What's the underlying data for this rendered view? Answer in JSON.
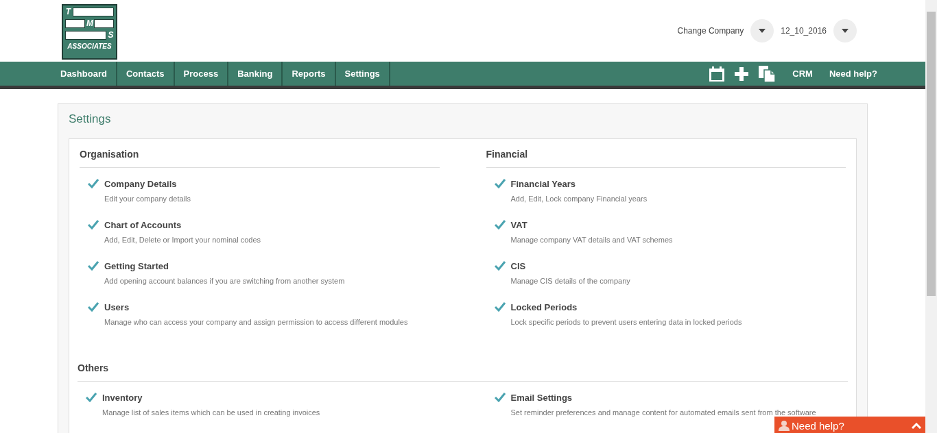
{
  "logo": {
    "letters": [
      "T",
      "M",
      "S"
    ],
    "caption": "ASSOCIATES"
  },
  "header": {
    "company_label": "Change Company",
    "period": "12_10_2016"
  },
  "nav": [
    "Dashboard",
    "Contacts",
    "Process",
    "Banking",
    "Reports",
    "Settings"
  ],
  "toolbar": {
    "crm": "CRM",
    "help": "Need help?"
  },
  "panel": {
    "title": "Settings",
    "sections": [
      {
        "title": "Organisation",
        "items": [
          {
            "title": "Company Details",
            "description": "Edit your company details"
          },
          {
            "title": "Chart of Accounts",
            "description": "Add, Edit, Delete or Import your nominal codes"
          },
          {
            "title": "Getting Started",
            "description": "Add opening account balances if you are switching from another system"
          },
          {
            "title": "Users",
            "description": "Manage who can access your company and assign permission to access different modules"
          }
        ]
      },
      {
        "title": "Financial",
        "items": [
          {
            "title": "Financial Years",
            "description": "Add, Edit, Lock company Financial years"
          },
          {
            "title": "VAT",
            "description": "Manage company VAT details and VAT schemes"
          },
          {
            "title": "CIS",
            "description": "Manage CIS details of the company"
          },
          {
            "title": "Locked Periods",
            "description": "Lock specific periods to prevent users entering data in locked periods"
          }
        ]
      }
    ],
    "others": {
      "title": "Others",
      "items": [
        {
          "title": "Inventory",
          "description": "Manage list of sales items which can be used in creating invoices"
        },
        {
          "title": "Email Settings",
          "description": "Set reminder preferences and manage content for automated emails sent from the software"
        }
      ]
    }
  },
  "help_widget": {
    "label": "Need help?"
  }
}
